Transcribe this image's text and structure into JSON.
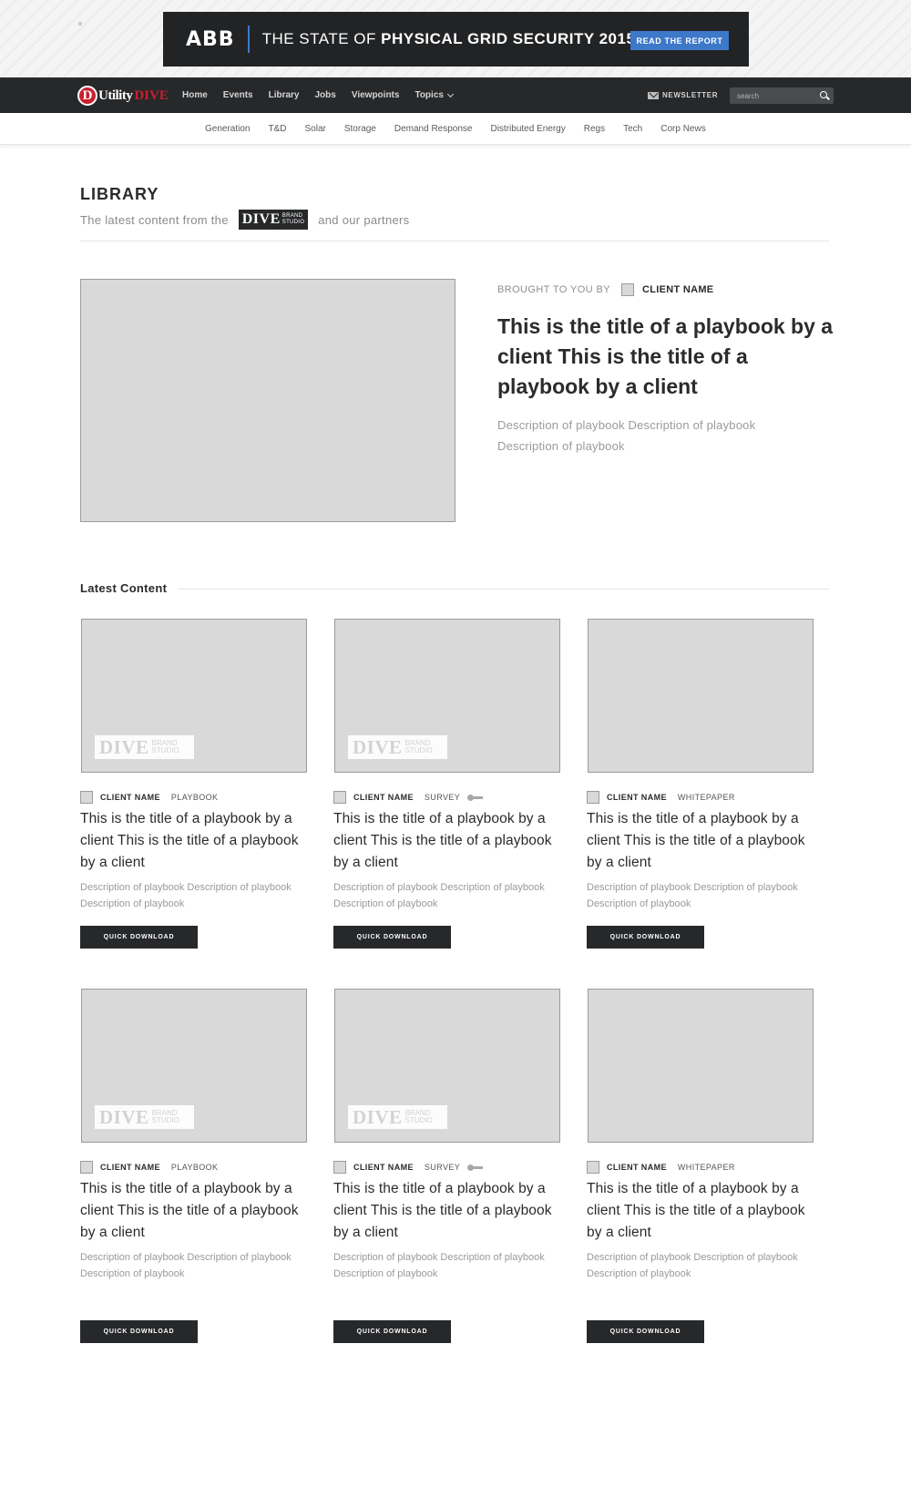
{
  "ad": {
    "logo": "ABB",
    "headline_light": "THE STATE OF",
    "headline_bold": "PHYSICAL GRID SECURITY 2015",
    "cta": "READ THE REPORT"
  },
  "nav": {
    "logo_letter": "D",
    "logo_utility": "Utility",
    "logo_dive": "DIVE",
    "links": [
      "Home",
      "Events",
      "Library",
      "Jobs",
      "Viewpoints",
      "Topics"
    ],
    "newsletter": "NEWSLETTER",
    "search_placeholder": "search"
  },
  "subnav": [
    "Generation",
    "T&D",
    "Solar",
    "Storage",
    "Demand Response",
    "Distributed Energy",
    "Regs",
    "Tech",
    "Corp News"
  ],
  "library": {
    "title": "LIBRARY",
    "sub_before": "The latest content from the",
    "badge_word": "DIVE",
    "badge_top": "BRAND",
    "badge_bottom": "STUDIO",
    "sub_after": "and our partners"
  },
  "featured": {
    "brought_label": "BROUGHT TO YOU BY",
    "client": "CLIENT NAME",
    "title": "This is the title of a playbook by a client This is the title of a playbook by a client",
    "description": "Description of playbook Description of playbook Description of playbook"
  },
  "latest": {
    "label": "Latest Content",
    "watermark_word": "DIVE",
    "watermark_top": "BRAND",
    "watermark_bottom": "STUDIO",
    "cards": [
      {
        "client": "CLIENT NAME",
        "type": "PLAYBOOK",
        "title": "This is the title of a playbook by a client This is the title of a playbook by a client",
        "description": "Description of playbook Description of playbook Description of playbook",
        "button": "QUICK DOWNLOAD"
      },
      {
        "client": "CLIENT NAME",
        "type": "SURVEY",
        "title": "This is the title of a playbook by a client This is the title of a playbook by a client",
        "description": "Description of playbook Description of playbook Description of playbook",
        "button": "QUICK DOWNLOAD"
      },
      {
        "client": "CLIENT NAME",
        "type": "WHITEPAPER",
        "title": "This is the title of a playbook by a client This is the title of a playbook by a client",
        "description": "Description of playbook Description of playbook Description of playbook",
        "button": "QUICK DOWNLOAD"
      },
      {
        "client": "CLIENT NAME",
        "type": "PLAYBOOK",
        "title": "This is the title of a playbook by a client This is the title of a playbook by a client",
        "description": "Description of playbook Description of playbook Description of playbook",
        "button": "QUICK DOWNLOAD"
      },
      {
        "client": "CLIENT NAME",
        "type": "SURVEY",
        "title": "This is the title of a playbook by a client This is the title of a playbook by a client",
        "description": "Description of playbook Description of playbook Description of playbook",
        "button": "QUICK DOWNLOAD"
      },
      {
        "client": "CLIENT NAME",
        "type": "WHITEPAPER",
        "title": "This is the title of a playbook by a client This is the title of a playbook by a client",
        "description": "Description of playbook Description of playbook Description of playbook",
        "button": "QUICK DOWNLOAD"
      }
    ]
  }
}
